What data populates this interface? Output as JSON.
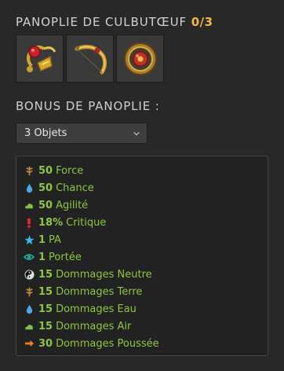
{
  "set": {
    "title": "PANOPLIE DE CULBUTŒUF",
    "count": "0/3",
    "items": [
      {
        "icon": "red-gold-amulet-icon"
      },
      {
        "icon": "golden-bow-icon"
      },
      {
        "icon": "round-shield-icon"
      }
    ]
  },
  "bonus": {
    "label": "BONUS DE PANOPLIE :",
    "select": {
      "value": "3 Objets"
    },
    "stats": [
      {
        "value": "50",
        "label": "Force",
        "icon": "earth-strength-icon",
        "color": "#c58b3a"
      },
      {
        "value": "50",
        "label": "Chance",
        "icon": "water-drop-icon",
        "color": "#4aa8e8"
      },
      {
        "value": "50",
        "label": "Agilité",
        "icon": "air-cloud-icon",
        "color": "#7ec144"
      },
      {
        "value": "18%",
        "label": "Critique",
        "icon": "critical-exclamation-icon",
        "color": "#e8282a"
      },
      {
        "value": "1",
        "label": "PA",
        "icon": "action-point-star-icon",
        "color": "#35b7e8"
      },
      {
        "value": "1",
        "label": "Portée",
        "icon": "range-eye-icon",
        "color": "#1fa89c"
      },
      {
        "value": "15",
        "label": "Dommages Neutre",
        "icon": "neutral-yinyang-icon",
        "color": "#e0e0e0"
      },
      {
        "value": "15",
        "label": "Dommages Terre",
        "icon": "earth-strength-icon",
        "color": "#c58b3a"
      },
      {
        "value": "15",
        "label": "Dommages Eau",
        "icon": "water-drop-icon",
        "color": "#4aa8e8"
      },
      {
        "value": "15",
        "label": "Dommages Air",
        "icon": "air-cloud-icon",
        "color": "#7ec144"
      },
      {
        "value": "30",
        "label": "Dommages Poussée",
        "icon": "pushback-arrow-icon",
        "color": "#f07d1a"
      }
    ]
  },
  "colors": {
    "stat_text": "#8ec63f",
    "count_accent": "#f0b93a",
    "background": "#282828"
  }
}
